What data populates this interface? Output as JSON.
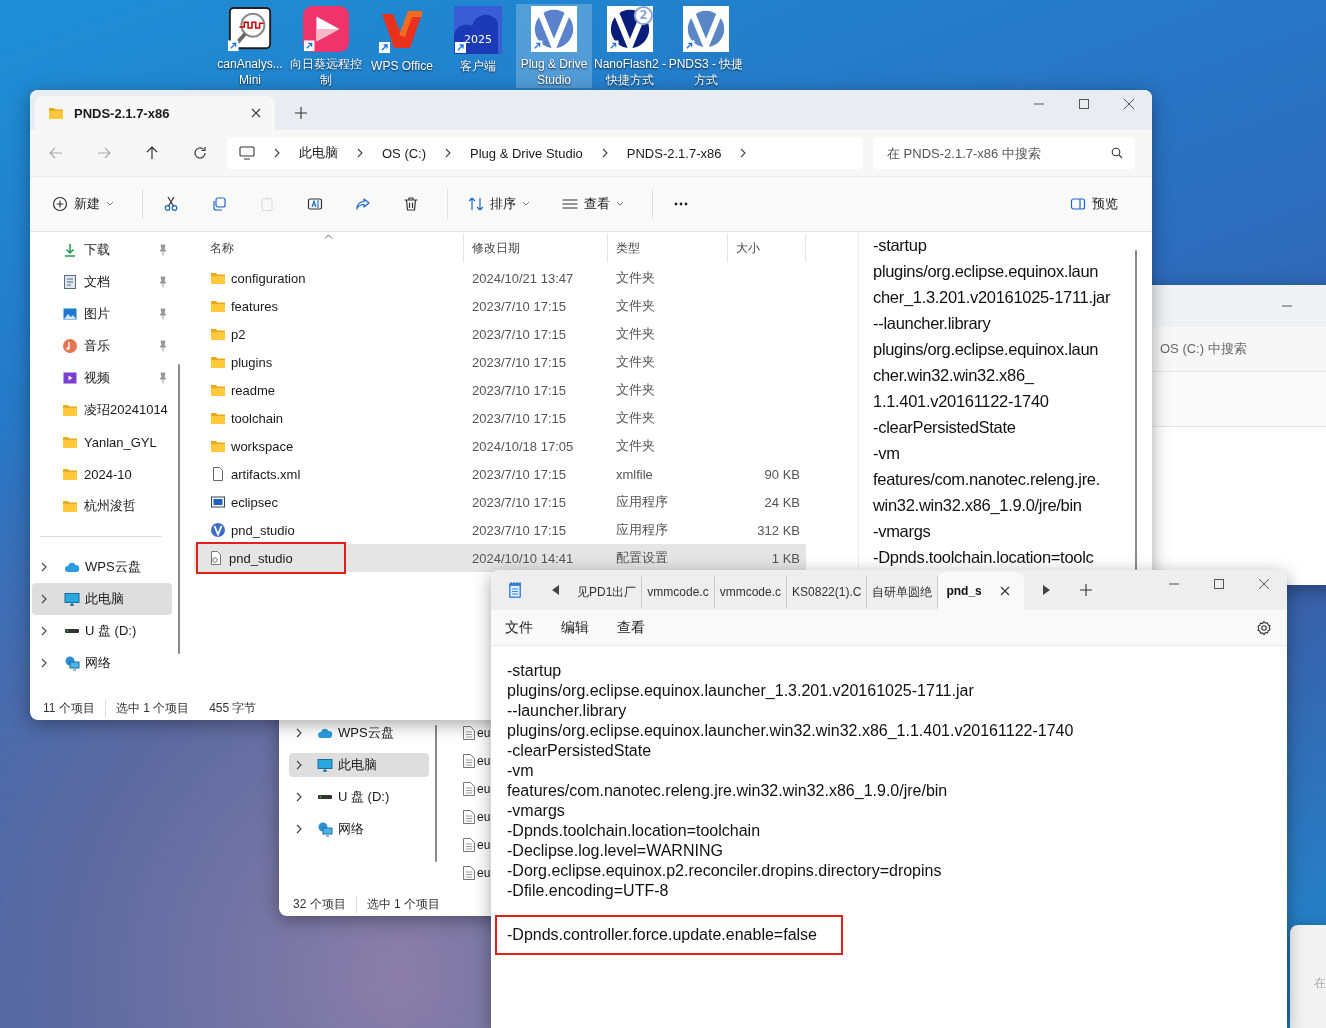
{
  "desktop_icons": [
    {
      "label": "canAnalys... Mini",
      "kind": "can_analyzer",
      "selected": false
    },
    {
      "label": "向日葵远程控制",
      "kind": "sunflower",
      "selected": false
    },
    {
      "label": "WPS Office",
      "kind": "wps",
      "selected": false
    },
    {
      "label": "客户端",
      "kind": "client",
      "badge": "2025",
      "selected": false
    },
    {
      "label": "Plug & Drive Studio",
      "kind": "pnd",
      "selected": true
    },
    {
      "label": "NanoFlash2 - 快捷方式",
      "kind": "nanoflash",
      "badge": "2",
      "selected": false
    },
    {
      "label": "PNDS3 - 快捷方式",
      "kind": "pnds3",
      "selected": false
    }
  ],
  "explorer": {
    "tab_title": "PNDS-2.1.7-x86",
    "breadcrumb": [
      "此电脑",
      "OS (C:)",
      "Plug & Drive Studio",
      "PNDS-2.1.7-x86"
    ],
    "search": {
      "placeholder": "在 PNDS-2.1.7-x86 中搜索"
    },
    "toolbar": [
      {
        "kind": "new",
        "label": "新建",
        "dropdown": true,
        "disabled": false
      },
      {
        "kind": "cut",
        "disabled": false
      },
      {
        "kind": "copy",
        "disabled": false
      },
      {
        "kind": "paste",
        "disabled": true
      },
      {
        "kind": "rename",
        "disabled": false
      },
      {
        "kind": "share",
        "disabled": false
      },
      {
        "kind": "delete",
        "disabled": false
      },
      {
        "kind": "sort",
        "label": "排序",
        "dropdown": true,
        "disabled": false
      },
      {
        "kind": "view",
        "label": "查看",
        "dropdown": true,
        "disabled": false
      },
      {
        "kind": "more",
        "disabled": false
      }
    ],
    "preview_button": "预览",
    "quick_access": [
      {
        "label": "下载",
        "kind": "download",
        "pinned": true
      },
      {
        "label": "文档",
        "kind": "document",
        "pinned": true
      },
      {
        "label": "图片",
        "kind": "picture",
        "pinned": true
      },
      {
        "label": "音乐",
        "kind": "music",
        "pinned": true
      },
      {
        "label": "视频",
        "kind": "video",
        "pinned": true
      },
      {
        "label": "凌玿20241014",
        "kind": "folder",
        "pinned": false
      },
      {
        "label": "Yanlan_GYL",
        "kind": "folder",
        "pinned": false
      },
      {
        "label": "2024-10",
        "kind": "folder",
        "pinned": false
      },
      {
        "label": "杭州浚哲",
        "kind": "folder",
        "pinned": false
      }
    ],
    "locations": [
      {
        "label": "WPS云盘",
        "kind": "cloud",
        "selected": false
      },
      {
        "label": "此电脑",
        "kind": "computer",
        "selected": true
      },
      {
        "label": "U 盘 (D:)",
        "kind": "drive",
        "selected": false
      },
      {
        "label": "网络",
        "kind": "network",
        "selected": false
      }
    ],
    "columns": [
      {
        "label": "名称",
        "sorted": true
      },
      {
        "label": "修改日期",
        "sorted": false
      },
      {
        "label": "类型",
        "sorted": false
      },
      {
        "label": "大小",
        "sorted": false
      }
    ],
    "files": [
      {
        "name": "configuration",
        "date": "2024/10/21 13:47",
        "type": "文件夹",
        "kind": "folder",
        "selected": false,
        "highlighted": false
      },
      {
        "name": "features",
        "date": "2023/7/10 17:15",
        "type": "文件夹",
        "kind": "folder",
        "selected": false,
        "highlighted": false
      },
      {
        "name": "p2",
        "date": "2023/7/10 17:15",
        "type": "文件夹",
        "kind": "folder",
        "selected": false,
        "highlighted": false
      },
      {
        "name": "plugins",
        "date": "2023/7/10 17:15",
        "type": "文件夹",
        "kind": "folder",
        "selected": false,
        "highlighted": false
      },
      {
        "name": "readme",
        "date": "2023/7/10 17:15",
        "type": "文件夹",
        "kind": "folder",
        "selected": false,
        "highlighted": false
      },
      {
        "name": "toolchain",
        "date": "2023/7/10 17:15",
        "type": "文件夹",
        "kind": "folder",
        "selected": false,
        "highlighted": false
      },
      {
        "name": "workspace",
        "date": "2024/10/18 17:05",
        "type": "文件夹",
        "kind": "folder",
        "selected": false,
        "highlighted": false
      },
      {
        "name": "artifacts.xml",
        "date": "2023/7/10 17:15",
        "type": "xmlfile",
        "size": "90 KB",
        "kind": "file",
        "selected": false,
        "highlighted": false
      },
      {
        "name": "eclipsec",
        "date": "2023/7/10 17:15",
        "type": "应用程序",
        "size": "24 KB",
        "kind": "app",
        "selected": false,
        "highlighted": false
      },
      {
        "name": "pnd_studio",
        "date": "2023/7/10 17:15",
        "type": "应用程序",
        "size": "312 KB",
        "kind": "pnd",
        "selected": false,
        "highlighted": false
      },
      {
        "name": "pnd_studio",
        "date": "2024/10/10 14:41",
        "type": "配置设置",
        "size": "1 KB",
        "kind": "config",
        "selected": true,
        "highlighted": true
      }
    ],
    "status": {
      "count": "11 个项目",
      "selection": "选中 1 个项目",
      "size": "455 字节"
    },
    "preview_lines": [
      "-startup",
      "plugins/org.eclipse.equinox.laun",
      "cher_1.3.201.v20161025-1711.jar",
      "--launcher.library",
      "plugins/org.eclipse.equinox.laun",
      "cher.win32.win32.x86_",
      "1.1.401.v20161122-1740",
      "-clearPersistedState",
      "-vm",
      "features/com.nanotec.releng.jre.",
      "win32.win32.x86_1.9.0/jre/bin",
      "-vmargs",
      "-Dpnds.toolchain.location=toolc"
    ]
  },
  "background_explorer": {
    "locations": [
      {
        "label": "WPS云盘",
        "kind": "cloud",
        "selected": false
      },
      {
        "label": "此电脑",
        "kind": "computer",
        "selected": true
      },
      {
        "label": "U 盘 (D:)",
        "kind": "drive",
        "selected": false
      },
      {
        "label": "网络",
        "kind": "network",
        "selected": false
      }
    ],
    "files": [
      "eu",
      "eu",
      "eu",
      "eu",
      "eu",
      "eu"
    ],
    "status": {
      "count": "32 个项目",
      "selection": "选中 1 个项目"
    }
  },
  "background_window": {
    "search_placeholder": "OS (C:) 中搜索"
  },
  "corner_window": {
    "text": "在"
  },
  "notepad": {
    "tabs": [
      {
        "label": "见PD1出厂",
        "selected": false
      },
      {
        "label": "vmmcode.c",
        "selected": false
      },
      {
        "label": "vmmcode.c",
        "selected": false
      },
      {
        "label": "KS0822(1).C",
        "selected": false
      },
      {
        "label": "自研单圆绝",
        "selected": false
      },
      {
        "label": "pnd_s",
        "selected": true
      }
    ],
    "menu": [
      "文件",
      "编辑",
      "查看"
    ],
    "lines": [
      {
        "text": "-startup",
        "highlighted": false
      },
      {
        "text": "plugins/org.eclipse.equinox.launcher_1.3.201.v20161025-1711.jar",
        "highlighted": false
      },
      {
        "text": "--launcher.library",
        "highlighted": false
      },
      {
        "text": "plugins/org.eclipse.equinox.launcher.win32.win32.x86_1.1.401.v20161122-1740",
        "highlighted": false
      },
      {
        "text": "-clearPersistedState",
        "highlighted": false
      },
      {
        "text": "-vm",
        "highlighted": false
      },
      {
        "text": "features/com.nanotec.releng.jre.win32.win32.x86_1.9.0/jre/bin",
        "highlighted": false
      },
      {
        "text": "-vmargs",
        "highlighted": false
      },
      {
        "text": "-Dpnds.toolchain.location=toolchain",
        "highlighted": false
      },
      {
        "text": "-Declipse.log.level=WARNING",
        "highlighted": false
      },
      {
        "text": "-Dorg.eclipse.equinox.p2.reconciler.dropins.directory=dropins",
        "highlighted": false
      },
      {
        "text": "-Dfile.encoding=UTF-8",
        "highlighted": false
      },
      {
        "text": "-Dpnds.controller.force.update.enable=false",
        "highlighted": true
      }
    ]
  }
}
